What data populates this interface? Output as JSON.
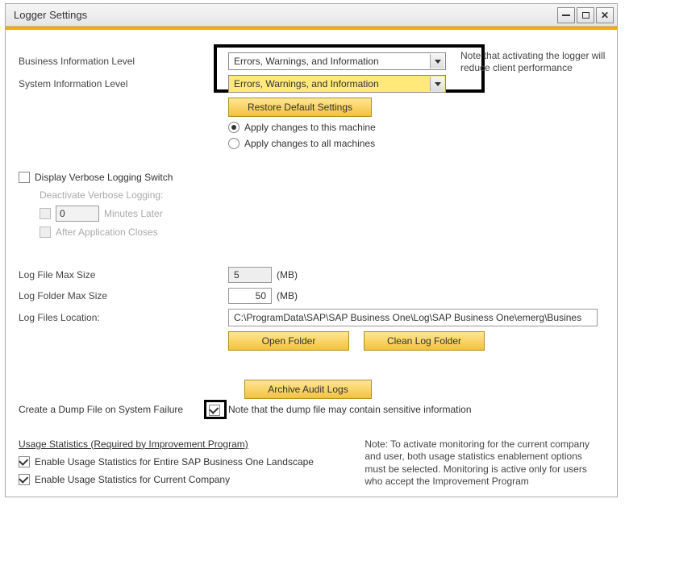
{
  "titlebar": {
    "title": "Logger Settings"
  },
  "labels": {
    "business_info": "Business Information Level",
    "system_info": "System Information Level",
    "display_verbose": "Display Verbose Logging Switch",
    "deactivate_verbose": "Deactivate Verbose Logging:",
    "minutes_later": "Minutes Later",
    "after_app_closes": "After Application Closes",
    "log_file_max": "Log File Max Size",
    "log_folder_max": "Log Folder Max Size",
    "log_files_loc": "Log Files Location:",
    "mb": "(MB)",
    "create_dump": "Create a Dump File on System Failure",
    "usage_header": "Usage Statistics (Required by Improvement Program)",
    "enable_entire": "Enable Usage Statistics for Entire SAP Business One Landscape",
    "enable_company": "Enable Usage Statistics for Current Company"
  },
  "selects": {
    "business_value": "Errors, Warnings, and Information",
    "system_value": "Errors, Warnings, and Information"
  },
  "notes": {
    "logger_warning": "Note that activating the logger will reduce client performance",
    "dump_warning": "Note that the dump file may contain sensitive information",
    "monitoring": "Note: To activate monitoring for the current company and user, both usage statistics enablement options must be selected. Monitoring is active only for users who accept the Improvement Program"
  },
  "buttons": {
    "restore": "Restore Default Settings",
    "open_folder": "Open Folder",
    "clean_folder": "Clean Log Folder",
    "archive": "Archive Audit Logs"
  },
  "radios": {
    "apply_this": "Apply changes to this machine",
    "apply_all": "Apply changes to all machines"
  },
  "values": {
    "minutes": "0",
    "file_max": "5",
    "folder_max": "50",
    "path": "C:\\ProgramData\\SAP\\SAP Business One\\Log\\SAP Business One\\emerg\\Busines"
  }
}
